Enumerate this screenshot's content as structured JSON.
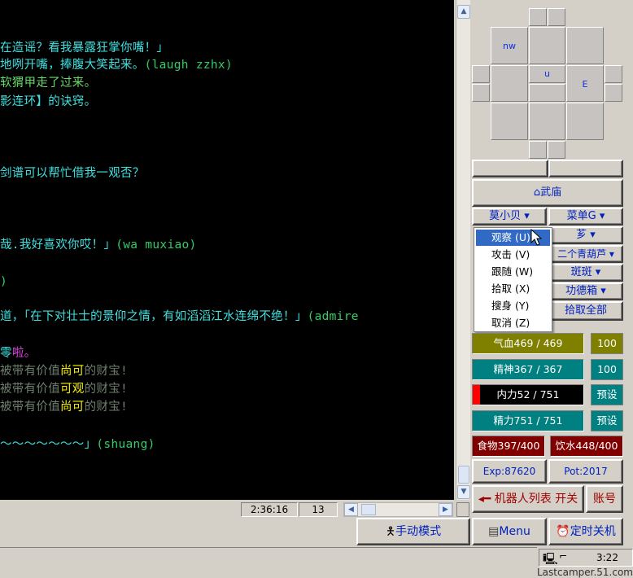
{
  "terminal": {
    "lines": [
      {
        "segs": [
          {
            "t": "在造谣？看我暴露狂掌你嘴！」",
            "c": "cy"
          }
        ]
      },
      {
        "segs": [
          {
            "t": "地咧开嘴，捧腹大笑起来。",
            "c": "cy"
          },
          {
            "t": "(laugh zzhx)",
            "c": "gr"
          }
        ]
      },
      {
        "segs": [
          {
            "t": "软猬甲走了过来。",
            "c": "lgr"
          }
        ]
      },
      {
        "segs": [
          {
            "t": "影连环】的诀窍。",
            "c": "cy"
          }
        ]
      },
      {
        "segs": [
          {
            "t": "剑谱可以帮忙借我一观否？",
            "c": "cy"
          }
        ]
      },
      {
        "segs": [
          {
            "t": "哉.我好喜欢你哎！」",
            "c": "cy"
          },
          {
            "t": "(wa muxiao)",
            "c": "gr"
          }
        ]
      },
      {
        "segs": [
          {
            "t": ")",
            "c": "gr"
          }
        ]
      },
      {
        "segs": [
          {
            "t": "道，「在下对壮士的景仰之情，有如滔滔江水连绵不绝！」",
            "c": "cy"
          },
          {
            "t": "(admire",
            "c": "gr"
          }
        ]
      },
      {
        "segs": [
          {
            "t": "零",
            "c": "cy"
          },
          {
            "t": "啦。",
            "c": "mag"
          }
        ]
      },
      {
        "segs": [
          {
            "t": "被带有价值",
            "c": "dg"
          },
          {
            "t": "尚可",
            "c": "yel"
          },
          {
            "t": "的财宝!",
            "c": "dg"
          }
        ]
      },
      {
        "segs": [
          {
            "t": "被带有价值",
            "c": "dg"
          },
          {
            "t": "可观",
            "c": "yel"
          },
          {
            "t": "的财宝!",
            "c": "dg"
          }
        ]
      },
      {
        "segs": [
          {
            "t": "被带有价值",
            "c": "dg"
          },
          {
            "t": "尚可",
            "c": "yel"
          },
          {
            "t": "的财宝!",
            "c": "dg"
          }
        ]
      },
      {
        "segs": [
          {
            "t": "～～～～～～～」",
            "c": "cy"
          },
          {
            "t": "(shuang)",
            "c": "gr"
          }
        ]
      }
    ]
  },
  "status": {
    "time": "2:36:16",
    "count": "13"
  },
  "nav": {
    "nw": "nw",
    "u": "u",
    "e": "E"
  },
  "buttons": {
    "location": "武庙",
    "target": "莫小贝 ▾",
    "menu_g": "菜单G ▾",
    "item1": "芗 ▾",
    "item2": "二个青葫芦 ▾",
    "item3": "斑斑 ▾",
    "item4": "功德箱 ▾",
    "pick_all": "拾取全部",
    "preset1": "预设",
    "preset2": "预设",
    "robot": "机器人列表 开关",
    "account": "账号",
    "manual": "手动模式",
    "menu": "Menu",
    "timer": "定时关机"
  },
  "context_menu": {
    "items": [
      "观察 (U)",
      "攻击 (V)",
      "跟随 (W)",
      "拾取 (X)",
      "搜身 (Y)",
      "取消 (Z)"
    ]
  },
  "stats": {
    "hp": "气血469 / 469",
    "hp_pct": "100",
    "jing": "精神367 / 367",
    "jing_pct": "100",
    "neili": "内力52 / 751",
    "jingli": "精力751 / 751",
    "food": "食物397/400",
    "water": "饮水448/400",
    "exp": "Exp:87620",
    "pot": "Pot:2017"
  },
  "tray": {
    "clock": "3:22"
  },
  "watermark": "Lastcamper.51.com",
  "colors": {
    "hp": "#808000",
    "teal": "#008080",
    "neili": "#000000",
    "food": "#800000",
    "terminal": "#000000"
  }
}
